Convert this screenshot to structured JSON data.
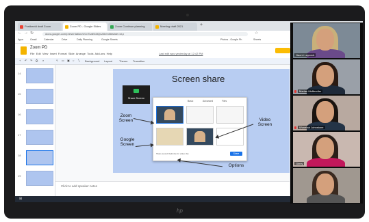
{
  "browser": {
    "tabs": [
      {
        "label": "Postbeeld draft Zoom",
        "color": "#ea4335"
      },
      {
        "label": "Zoom PD - Google Slides",
        "color": "#f4b400"
      },
      {
        "label": "Zoom Continue planning",
        "color": "#34a853"
      },
      {
        "label": "Meeting draft 2021",
        "color": "#f4b400"
      }
    ],
    "url": "docs.google.com/presentation/d/1xTkaE63tQ4Z8r/edit#slide=id.p",
    "bookmarks": [
      "Apps",
      "Gmail",
      "Calendar",
      "Drive",
      "Daily Planning",
      "Google Sheets",
      "Photos - Google Ph",
      "Sheets"
    ]
  },
  "slides_app": {
    "doc_title": "Zoom PD",
    "menu": [
      "File",
      "Edit",
      "View",
      "Insert",
      "Format",
      "Slide",
      "Arrange",
      "Tools",
      "Add-ons",
      "Help"
    ],
    "last_edit": "Last edit was yesterday at 12:42 PM",
    "toolbar": {
      "background_label": "Background",
      "layout_label": "Layout",
      "theme_label": "Theme",
      "transition_label": "Transition"
    },
    "slide_numbers": [
      "14",
      "15",
      "16",
      "17",
      "18",
      "19"
    ],
    "speaker_notes_placeholder": "Click to add speaker notes"
  },
  "slide": {
    "title": "Screen share",
    "share_button_label": "Share Screen",
    "dialog": {
      "tabs": [
        "Basic",
        "Advanced",
        "Files"
      ],
      "share_label": "Share",
      "footer": "Share sound   Optimize for video clip"
    },
    "annotations": {
      "zoom_screen": "Zoom Screen",
      "google_screen": "Google Screen",
      "video_screen": "Video Screen",
      "options": "Options"
    }
  },
  "participants": [
    {
      "name": "Naomi Laycock",
      "hair": "#c9b07a",
      "shirt": "#6a4a8a",
      "bg": "#7d8a96",
      "muted": false
    },
    {
      "name": "Marian Muffendler",
      "hair": "#2a1a12",
      "shirt": "#1e2a3a",
      "bg": "#9aa0a8",
      "muted": true
    },
    {
      "name": "Wonetah Johnstone",
      "hair": "#1a1410",
      "shirt": "#243447",
      "bg": "#b8a9a0",
      "muted": true
    },
    {
      "name": "Ginny",
      "hair": "#2a1e18",
      "shirt": "#c2185b",
      "bg": "#c9b8b0",
      "muted": false
    },
    {
      "name": "",
      "hair": "#3a2a20",
      "shirt": "#555555",
      "bg": "#a09890",
      "muted": false
    }
  ],
  "colors": {
    "accent": "#1a73e8",
    "slide_bg": "#b8cdf2",
    "zoom_green": "#2dbf5a"
  },
  "device": {
    "brand": "hp"
  }
}
